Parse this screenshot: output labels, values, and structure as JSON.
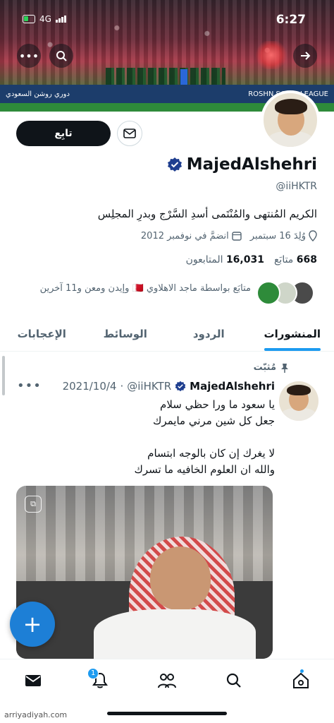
{
  "status_bar": {
    "time": "6:27",
    "network": "4G"
  },
  "profile": {
    "name": "MajedAlshehri",
    "handle": "@iiHKTR",
    "bio": "الكريم المُنتهى والمُنْتَمى أسدِ السَّرْج وبدرِ المجلِس",
    "birthday": "وُلِدَ 16 سبتمبر",
    "joined": "انضمَّ في نوفمبر 2012",
    "following_count": "668",
    "following_label": "متابَع",
    "followers_count": "16,031",
    "followers_label": "المتابعون",
    "followed_by_text": "متابَع بواسطة ماجد الاهلاوي 🇧🇭 وإيدن ومعن و11 آخرين",
    "follow_button": "تابِع"
  },
  "banner": {
    "ad_left": "دوري روشن السعودي",
    "ad_right": "ROSHN SAUDI LEAGUE"
  },
  "tabs": [
    "المنشورات",
    "الردود",
    "الوسائط",
    "الإعجابات"
  ],
  "tweet": {
    "pinned_label": "مُثبّت",
    "author": "MajedAlshehri",
    "handle": "@iiHKTR",
    "date": "2021/10/4",
    "lines": [
      "يا سعود ما ورا حظي سلام",
      "جعل كل شين مرني مايمرك",
      "لا يغرك إن كان بالوجه ابتسام",
      "والله ان العلوم الخافيه ما تسرك"
    ]
  },
  "nav": {
    "notification_count": "1"
  },
  "watermark": "arriyadiyah.com",
  "colors": {
    "accent": "#1d9bf0",
    "fab": "#1d7fd6",
    "text": "#0f1419",
    "muted": "#536471"
  },
  "icons": [
    "more-icon",
    "search-icon",
    "forward-arrow-icon",
    "mail-icon",
    "verified-icon",
    "location-icon",
    "calendar-icon",
    "pin-icon",
    "gif-icon",
    "plus-icon",
    "home-icon",
    "communities-icon",
    "bell-icon",
    "messages-icon"
  ]
}
